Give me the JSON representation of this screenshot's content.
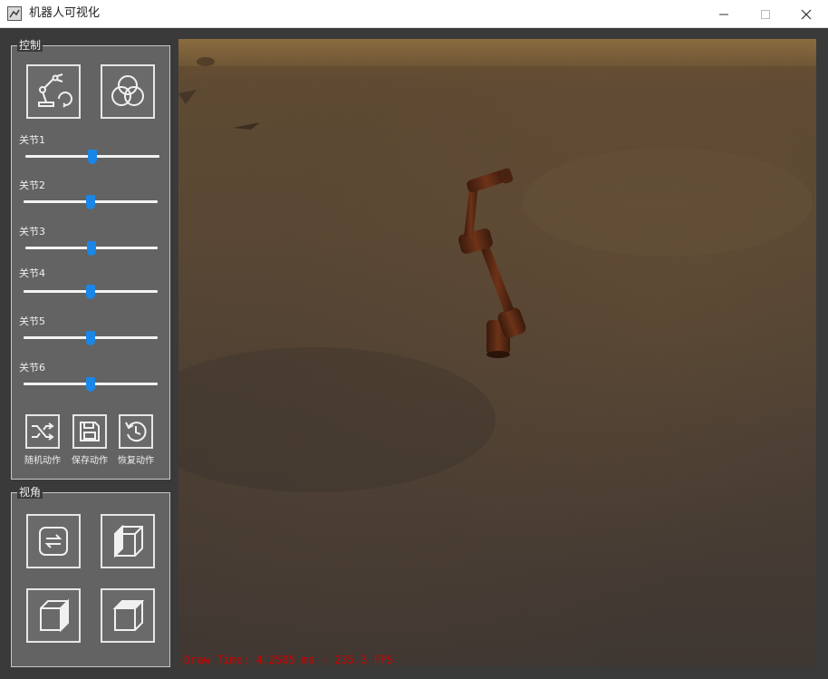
{
  "window": {
    "title": "机器人可视化"
  },
  "controls": {
    "group_title": "控制",
    "joints": [
      {
        "label": "关节1",
        "value": 0.5
      },
      {
        "label": "关节2",
        "value": 0.5
      },
      {
        "label": "关节3",
        "value": 0.5
      },
      {
        "label": "关节4",
        "value": 0.5
      },
      {
        "label": "关节5",
        "value": 0.5
      },
      {
        "label": "关节6",
        "value": 0.5
      }
    ],
    "actions": {
      "random": "随机动作",
      "save": "保存动作",
      "restore": "恢复动作"
    }
  },
  "view": {
    "group_title": "视角"
  },
  "viewport": {
    "fps_text": "Draw Time: 4.2505 ms - 235.3 FPS"
  },
  "colors": {
    "slider_thumb": "#1a86e8",
    "fps_text": "#d00000",
    "panel_bg": "#636363"
  }
}
